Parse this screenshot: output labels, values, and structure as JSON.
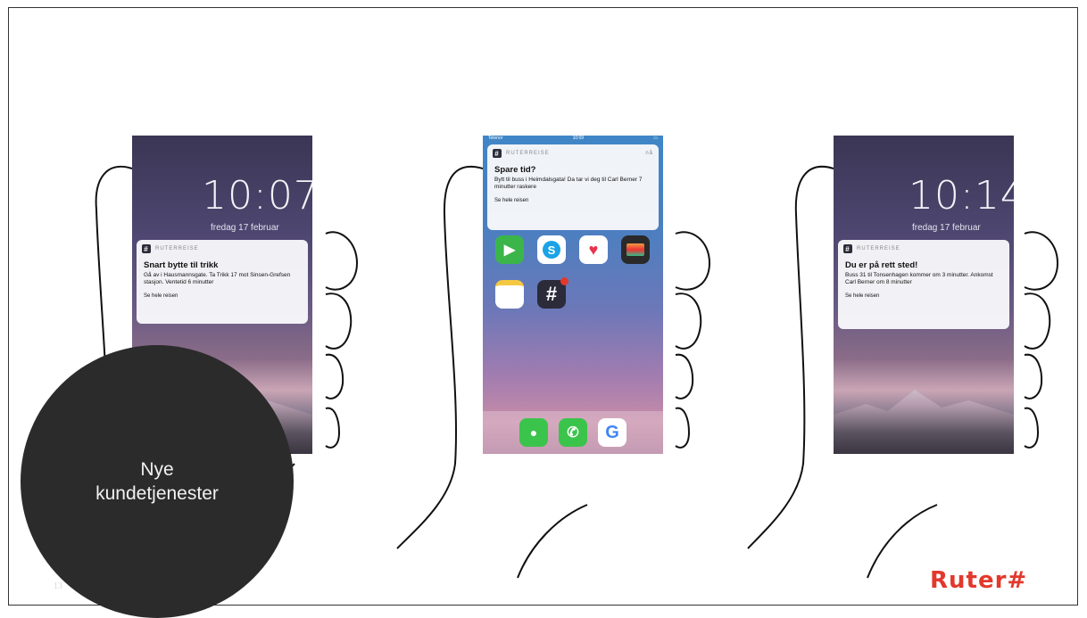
{
  "phone_left": {
    "time": "10:07",
    "date": "fredag 17 februar",
    "app_name": "RUTERREISE",
    "title": "Snart bytte til trikk",
    "body": "Gå av i Hausmannsgate. Ta Trikk 17 mot Sinsen-Grefsen stasjon. Ventetid 6 minutter",
    "link": "Se hele reisen"
  },
  "phone_middle": {
    "carrier": "Telenor",
    "clock": "10:09",
    "app_name": "RUTERREISE",
    "time_ago": "nå",
    "title": "Spare tid?",
    "body": "Bytt til buss i Heimdalsgata! Da tar vi deg til Carl Berner 7 minutter raskere",
    "link": "Se hele reisen",
    "apps": [
      "FaceTime",
      "Skype",
      "Health",
      "Wallet",
      "Notes",
      "RuterReise"
    ],
    "dock_apps": [
      "Messages",
      "Phone",
      "Google"
    ]
  },
  "phone_right": {
    "time": "10:14",
    "date": "fredag 17 februar",
    "app_name": "RUTERREISE",
    "title": "Du er på rett sted!",
    "body": "Buss 31 til Tonsenhagen kommer om 3 minutter. Ankomst Carl Berner om 8 minutter",
    "link": "Se hele reisen"
  },
  "circle_label_line1": "Nye",
  "circle_label_line2": "kundetjenester",
  "page_number": "13",
  "logo_text": "Ruter#",
  "colors": {
    "accent": "#e2392c",
    "circle": "#2c2b2b"
  }
}
